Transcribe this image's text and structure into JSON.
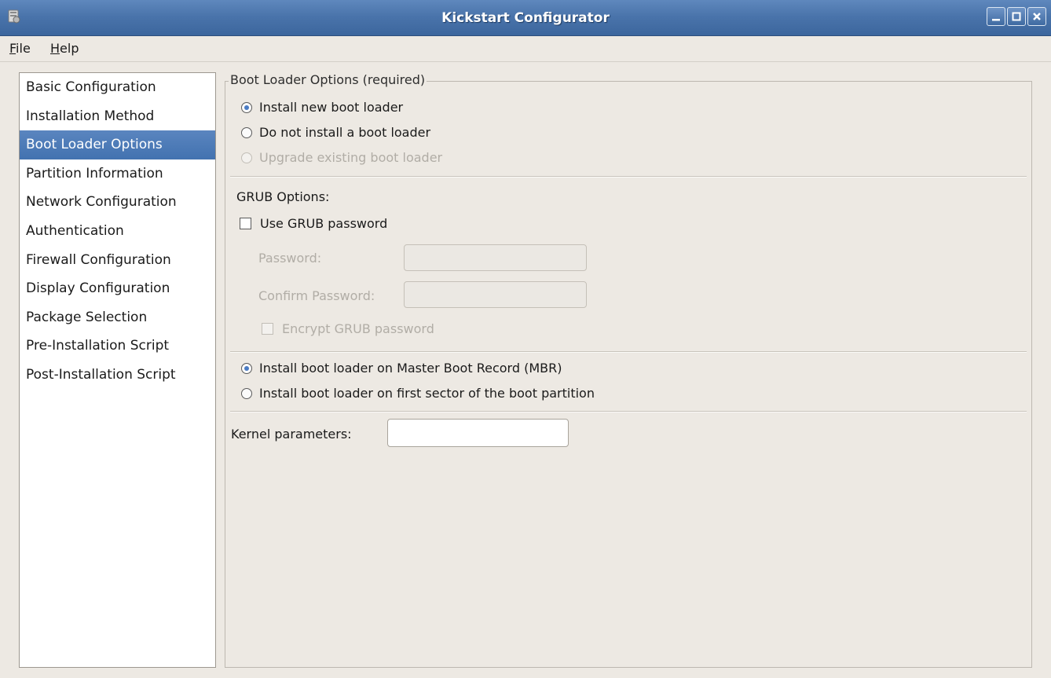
{
  "window": {
    "title": "Kickstart Configurator",
    "icon": "app-icon",
    "controls": [
      "minimize-icon",
      "maximize-icon",
      "close-icon"
    ]
  },
  "menu": {
    "file": {
      "mnemonic": "F",
      "rest": "ile"
    },
    "help": {
      "mnemonic": "H",
      "rest": "elp"
    }
  },
  "sidebar": {
    "selected_index": 2,
    "items": [
      {
        "label": "Basic Configuration"
      },
      {
        "label": "Installation Method"
      },
      {
        "label": "Boot Loader Options"
      },
      {
        "label": "Partition Information"
      },
      {
        "label": "Network Configuration"
      },
      {
        "label": "Authentication"
      },
      {
        "label": "Firewall Configuration"
      },
      {
        "label": "Display Configuration"
      },
      {
        "label": "Package Selection"
      },
      {
        "label": "Pre-Installation Script"
      },
      {
        "label": "Post-Installation Script"
      }
    ]
  },
  "boot_loader": {
    "frame_title": "Boot Loader Options (required)",
    "install_new": {
      "label": "Install new boot loader",
      "selected": true
    },
    "do_not_install": {
      "label": "Do not install a boot loader",
      "selected": false
    },
    "upgrade_existing": {
      "label": "Upgrade existing boot loader",
      "selected": false,
      "enabled": false
    }
  },
  "grub": {
    "heading": "GRUB Options:",
    "use_password": {
      "label": "Use GRUB password",
      "checked": false
    },
    "password_label": "Password:",
    "password_value": "",
    "confirm_label": "Confirm Password:",
    "confirm_value": "",
    "encrypt": {
      "label": "Encrypt GRUB password",
      "checked": false,
      "enabled": false
    }
  },
  "location": {
    "mbr": {
      "label": "Install boot loader on Master Boot Record (MBR)",
      "selected": true
    },
    "first_sector": {
      "label": "Install boot loader on first sector of the boot partition",
      "selected": false
    }
  },
  "kernel": {
    "label": "Kernel parameters:",
    "value": ""
  },
  "colors": {
    "titlebar": "#4a74ab",
    "selection": "#4a78b6",
    "window_bg": "#ede9e3",
    "disabled_text": "#b1ada6"
  }
}
